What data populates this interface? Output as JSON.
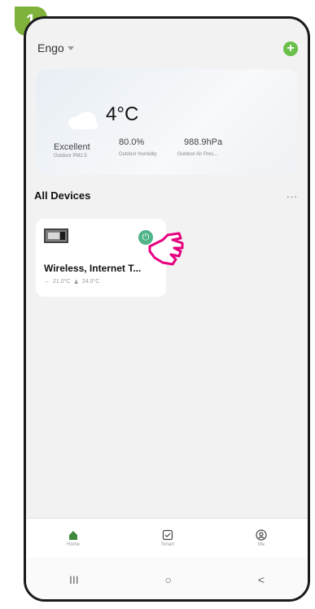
{
  "step_badge": "1",
  "header": {
    "home_name": "Engo",
    "add_label": "+"
  },
  "weather": {
    "temperature": "4°C",
    "metrics": [
      {
        "value": "Excellent",
        "label": "Outdoor PM2.5"
      },
      {
        "value": "80.0%",
        "label": "Outdoor Humidity"
      },
      {
        "value": "988.9hPa",
        "label": "Outdoor Air Pres..."
      }
    ]
  },
  "devices_section": {
    "title": "All Devices",
    "more": "...",
    "device": {
      "name": "Wireless, Internet T...",
      "current_temp": "21.0°C",
      "set_temp": "24.0°C"
    }
  },
  "tabs": [
    {
      "label": "Home",
      "icon": "home-icon",
      "active": true
    },
    {
      "label": "Smart",
      "icon": "smart-checkbox-icon",
      "active": false
    },
    {
      "label": "Me",
      "icon": "profile-icon",
      "active": false
    }
  ],
  "navbar": {
    "recents": "III",
    "home": "○",
    "back": "<"
  },
  "colors": {
    "accent": "#6abf4b",
    "badge": "#7fb23a",
    "power": "#4fb48a",
    "hand": "#e6007e"
  }
}
